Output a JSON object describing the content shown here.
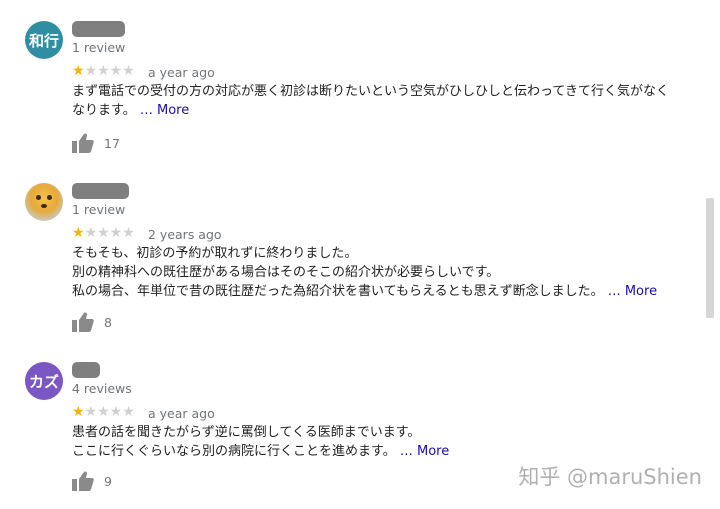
{
  "reviews": [
    {
      "avatar_text": "和行",
      "avatar_color": "#2f8ea1",
      "review_count": "1 review",
      "rating": 1,
      "age": "a year ago",
      "lines": [
        "まず電話での受付の方の対応が悪く初診は断りたいという空気がひしひしと伝わってきて行く気がなく",
        "なります。 "
      ],
      "more": "… More",
      "likes": "17"
    },
    {
      "avatar_text": "",
      "avatar_color": "#e7a93a",
      "review_count": "1 review",
      "rating": 1,
      "age": "2 years ago",
      "lines": [
        "そもそも、初診の予約が取れずに終わりました。",
        "別の精神科への既往歴がある場合はそのそこの紹介状が必要らしいです。",
        "私の場合、年単位で昔の既往歴だった為紹介状を書いてもらえるとも思えず断念しました。 "
      ],
      "more": "… More",
      "likes": "8"
    },
    {
      "avatar_text": "カズ",
      "avatar_color": "#7b57c4",
      "review_count": "4 reviews",
      "rating": 1,
      "age": "a year ago",
      "lines": [
        "患者の話を聞きたがらず逆に罵倒してくる医師までいます。",
        "ここに行くぐらいなら別の病院に行くことを進めます。 "
      ],
      "more": "… More",
      "likes": "9"
    }
  ],
  "watermark": "知乎 @maruShien",
  "colors": {
    "star_on": "#f5b301",
    "star_off": "#d0d0d0",
    "link": "#1a0dab"
  },
  "icons": {
    "like": "thumbs-up-icon",
    "star": "star-icon"
  }
}
